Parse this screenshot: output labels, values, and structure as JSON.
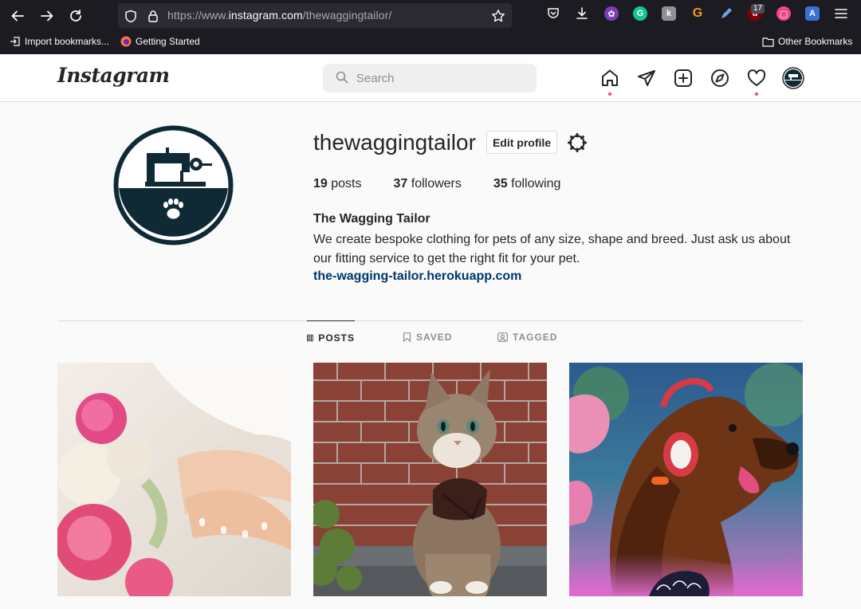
{
  "browser": {
    "url_prefix": "https://www.",
    "url_domain": "instagram.com",
    "url_path": "/thewaggingtailor/",
    "extension_badge": "17",
    "bookmarks": [
      {
        "label": "Import bookmarks..."
      },
      {
        "label": "Getting Started"
      }
    ],
    "other_bookmarks": "Other Bookmarks"
  },
  "instagram": {
    "logo": "Instagram",
    "search_placeholder": "Search"
  },
  "profile": {
    "username": "thewaggingtailor",
    "edit_label": "Edit profile",
    "posts_count": "19",
    "posts_label": "posts",
    "followers_count": "37",
    "followers_label": "followers",
    "following_count": "35",
    "following_label": "following",
    "full_name": "The Wagging Tailor",
    "bio": "We create bespoke clothing for pets of any size, shape and breed. Just ask us about our fitting service to get the right fit for your pet.",
    "website": "the-wagging-tailor.herokuapp.com"
  },
  "tabs": [
    {
      "label": "POSTS",
      "icon": "grid-icon"
    },
    {
      "label": "SAVED",
      "icon": "bookmark-icon"
    },
    {
      "label": "TAGGED",
      "icon": "tag-icon"
    }
  ],
  "colors": {
    "brand_navy": "#0f2a35",
    "link": "#00376b",
    "notification": "#ed4956"
  }
}
